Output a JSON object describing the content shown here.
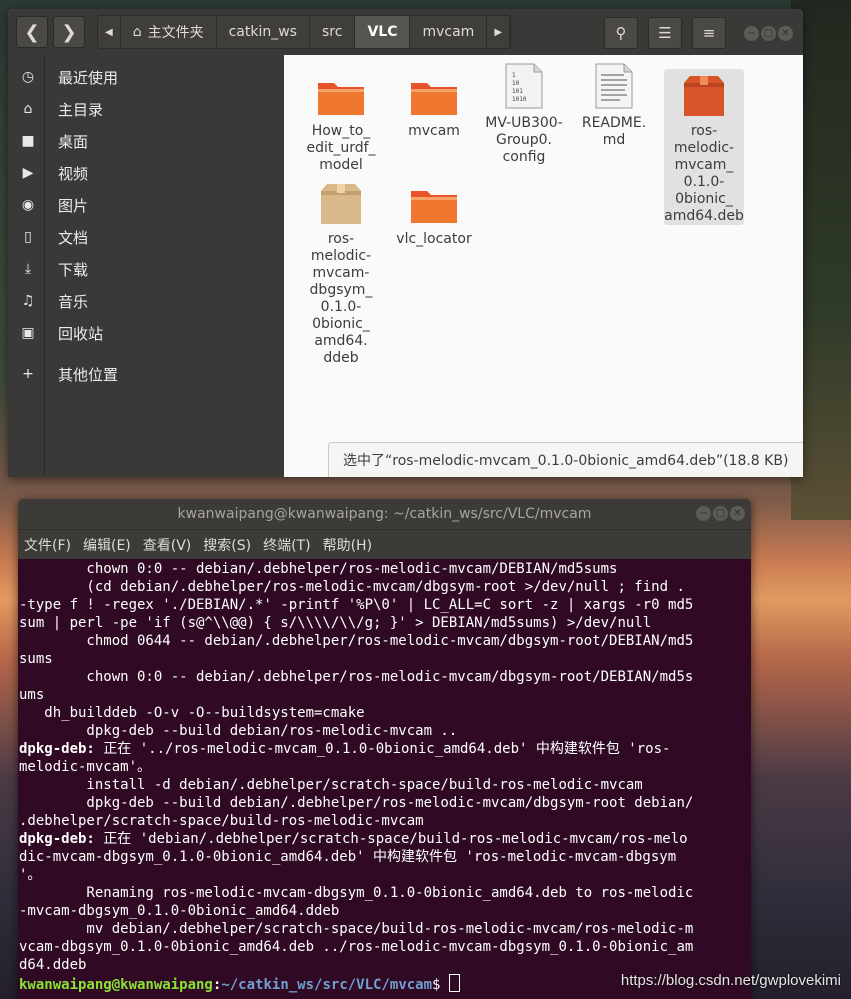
{
  "watermark": "https://blog.csdn.net/gwplovekimi",
  "file_manager": {
    "path": [
      "主文件夹",
      "catkin_ws",
      "src",
      "VLC",
      "mvcam"
    ],
    "active_crumb": "VLC",
    "sidebar": [
      {
        "icon": "clock-icon",
        "label": "最近使用"
      },
      {
        "icon": "home-icon",
        "label": "主目录"
      },
      {
        "icon": "folder-icon",
        "label": "桌面"
      },
      {
        "icon": "video-icon",
        "label": "视频"
      },
      {
        "icon": "camera-icon",
        "label": "图片"
      },
      {
        "icon": "document-icon",
        "label": "文档"
      },
      {
        "icon": "download-icon",
        "label": "下载"
      },
      {
        "icon": "music-icon",
        "label": "音乐"
      },
      {
        "icon": "trash-icon",
        "label": "回收站"
      },
      {
        "icon": "plus-icon",
        "label": "其他位置"
      }
    ],
    "files": [
      {
        "name": "How_to_\nedit_urdf_\nmodel",
        "type": "folder"
      },
      {
        "name": "mvcam",
        "type": "folder"
      },
      {
        "name": "MV-UB300-\nGroup0.\nconfig",
        "type": "binary"
      },
      {
        "name": "README.\nmd",
        "type": "text"
      },
      {
        "name": "ros-\nmelodic-\nmvcam_\n0.1.0-\n0bionic_\namd64.deb",
        "type": "deb",
        "selected": true
      },
      {
        "name": "ros-\nmelodic-\nmvcam-\ndbgsym_\n0.1.0-\n0bionic_\namd64.\nddeb",
        "type": "ddeb"
      },
      {
        "name": "vlc_locator",
        "type": "folder"
      }
    ],
    "status": "选中了“ros-melodic-mvcam_0.1.0-0bionic_amd64.deb”(18.8 KB)"
  },
  "terminal": {
    "title": "kwanwaipang@kwanwaipang: ~/catkin_ws/src/VLC/mvcam",
    "menu": [
      "文件(F)",
      "编辑(E)",
      "查看(V)",
      "搜索(S)",
      "终端(T)",
      "帮助(H)"
    ],
    "lines": [
      {
        "t": "        chown 0:0 -- debian/.debhelper/ros-melodic-mvcam/DEBIAN/md5sums"
      },
      {
        "t": "        (cd debian/.debhelper/ros-melodic-mvcam/dbgsym-root >/dev/null ; find ."
      },
      {
        "t": "-type f ! -regex './DEBIAN/.*' -printf '%P\\0' | LC_ALL=C sort -z | xargs -r0 md5"
      },
      {
        "t": "sum | perl -pe 'if (s@^\\\\@@) { s/\\\\\\\\/\\\\/g; }' > DEBIAN/md5sums) >/dev/null"
      },
      {
        "t": "        chmod 0644 -- debian/.debhelper/ros-melodic-mvcam/dbgsym-root/DEBIAN/md5"
      },
      {
        "t": "sums"
      },
      {
        "t": "        chown 0:0 -- debian/.debhelper/ros-melodic-mvcam/dbgsym-root/DEBIAN/md5s"
      },
      {
        "t": "ums"
      },
      {
        "t": "   dh_builddeb -O-v -O--buildsystem=cmake"
      },
      {
        "t": "        dpkg-deb --build debian/ros-melodic-mvcam .."
      },
      {
        "b": "dpkg-deb:",
        "t": " 正在 '../ros-melodic-mvcam_0.1.0-0bionic_amd64.deb' 中构建软件包 'ros-"
      },
      {
        "t": "melodic-mvcam'。"
      },
      {
        "t": "        install -d debian/.debhelper/scratch-space/build-ros-melodic-mvcam"
      },
      {
        "t": "        dpkg-deb --build debian/.debhelper/ros-melodic-mvcam/dbgsym-root debian/"
      },
      {
        "t": ".debhelper/scratch-space/build-ros-melodic-mvcam"
      },
      {
        "b": "dpkg-deb:",
        "t": " 正在 'debian/.debhelper/scratch-space/build-ros-melodic-mvcam/ros-melo"
      },
      {
        "t": "dic-mvcam-dbgsym_0.1.0-0bionic_amd64.deb' 中构建软件包 'ros-melodic-mvcam-dbgsym"
      },
      {
        "t": "'。"
      },
      {
        "t": "        Renaming ros-melodic-mvcam-dbgsym_0.1.0-0bionic_amd64.deb to ros-melodic"
      },
      {
        "t": "-mvcam-dbgsym_0.1.0-0bionic_amd64.ddeb"
      },
      {
        "t": "        mv debian/.debhelper/scratch-space/build-ros-melodic-mvcam/ros-melodic-m"
      },
      {
        "t": "vcam-dbgsym_0.1.0-0bionic_amd64.deb ../ros-melodic-mvcam-dbgsym_0.1.0-0bionic_am"
      },
      {
        "t": "d64.ddeb"
      }
    ],
    "prompt_user": "kwanwaipang@kwanwaipang",
    "prompt_path": "~/catkin_ws/src/VLC/mvcam",
    "prompt_symbol": "$ "
  }
}
